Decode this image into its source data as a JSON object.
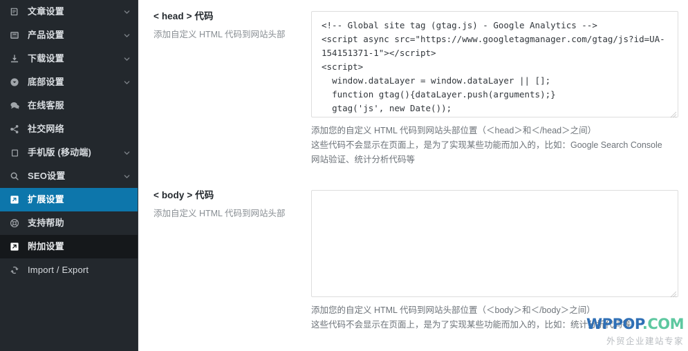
{
  "sidebar": {
    "items": [
      {
        "label": "文章设置",
        "icon": "article-icon",
        "chevron": true,
        "state": "normal"
      },
      {
        "label": "产品设置",
        "icon": "product-icon",
        "chevron": true,
        "state": "normal"
      },
      {
        "label": "下载设置",
        "icon": "download-icon",
        "chevron": true,
        "state": "normal"
      },
      {
        "label": "底部设置",
        "icon": "footer-icon",
        "chevron": true,
        "state": "normal"
      },
      {
        "label": "在线客服",
        "icon": "chat-icon",
        "chevron": false,
        "state": "normal"
      },
      {
        "label": "社交网络",
        "icon": "share-icon",
        "chevron": false,
        "state": "normal"
      },
      {
        "label": "手机版 (移动端)",
        "icon": "mobile-icon",
        "chevron": true,
        "state": "normal"
      },
      {
        "label": "SEO设置",
        "icon": "search-icon",
        "chevron": true,
        "state": "normal"
      },
      {
        "label": "扩展设置",
        "icon": "extension-icon",
        "chevron": false,
        "state": "active"
      },
      {
        "label": "支持帮助",
        "icon": "lifebuoy-icon",
        "chevron": false,
        "state": "normal"
      },
      {
        "label": "附加设置",
        "icon": "external-icon",
        "chevron": false,
        "state": "dark"
      },
      {
        "label": "Import / Export",
        "icon": "sync-icon",
        "chevron": false,
        "state": "normal"
      }
    ]
  },
  "sections": [
    {
      "title": "< head > 代码",
      "desc": "添加自定义 HTML 代码到网站头部",
      "code_value": "<!-- Global site tag (gtag.js) - Google Analytics -->\n<script async src=\"https://www.googletagmanager.com/gtag/js?id=UA-154151371-1\"></script>\n<script>\n  window.dataLayer = window.dataLayer || [];\n  function gtag(){dataLayer.push(arguments);}\n  gtag('js', new Date());",
      "help_lines": [
        "添加您的自定义 HTML 代码到网站头部位置（＜head＞和＜/head＞之间）",
        "这些代码不会显示在页面上，是为了实现某些功能而加入的，比如：Google Search Console",
        "网站验证、统计分析代码等"
      ]
    },
    {
      "title": "< body > 代码",
      "desc": "添加自定义 HTML 代码到网站头部",
      "code_value": "",
      "help_lines": [
        "添加您的自定义 HTML 代码到网站头部位置（＜body＞和＜/body＞之间）",
        "这些代码不会显示在页面上，是为了实现某些功能而加入的，比如：统计分析代码等"
      ]
    }
  ],
  "watermark": {
    "part1": "WP",
    "part2": "POP",
    "part3": ".COM",
    "subtitle": "外贸企业建站专家"
  },
  "colors": {
    "sidebar_bg": "#23282d",
    "sidebar_active": "#0d76ab",
    "sidebar_dark": "#15181b",
    "text_primary": "#23282d",
    "text_muted": "#888e93",
    "border": "#dddddd"
  }
}
